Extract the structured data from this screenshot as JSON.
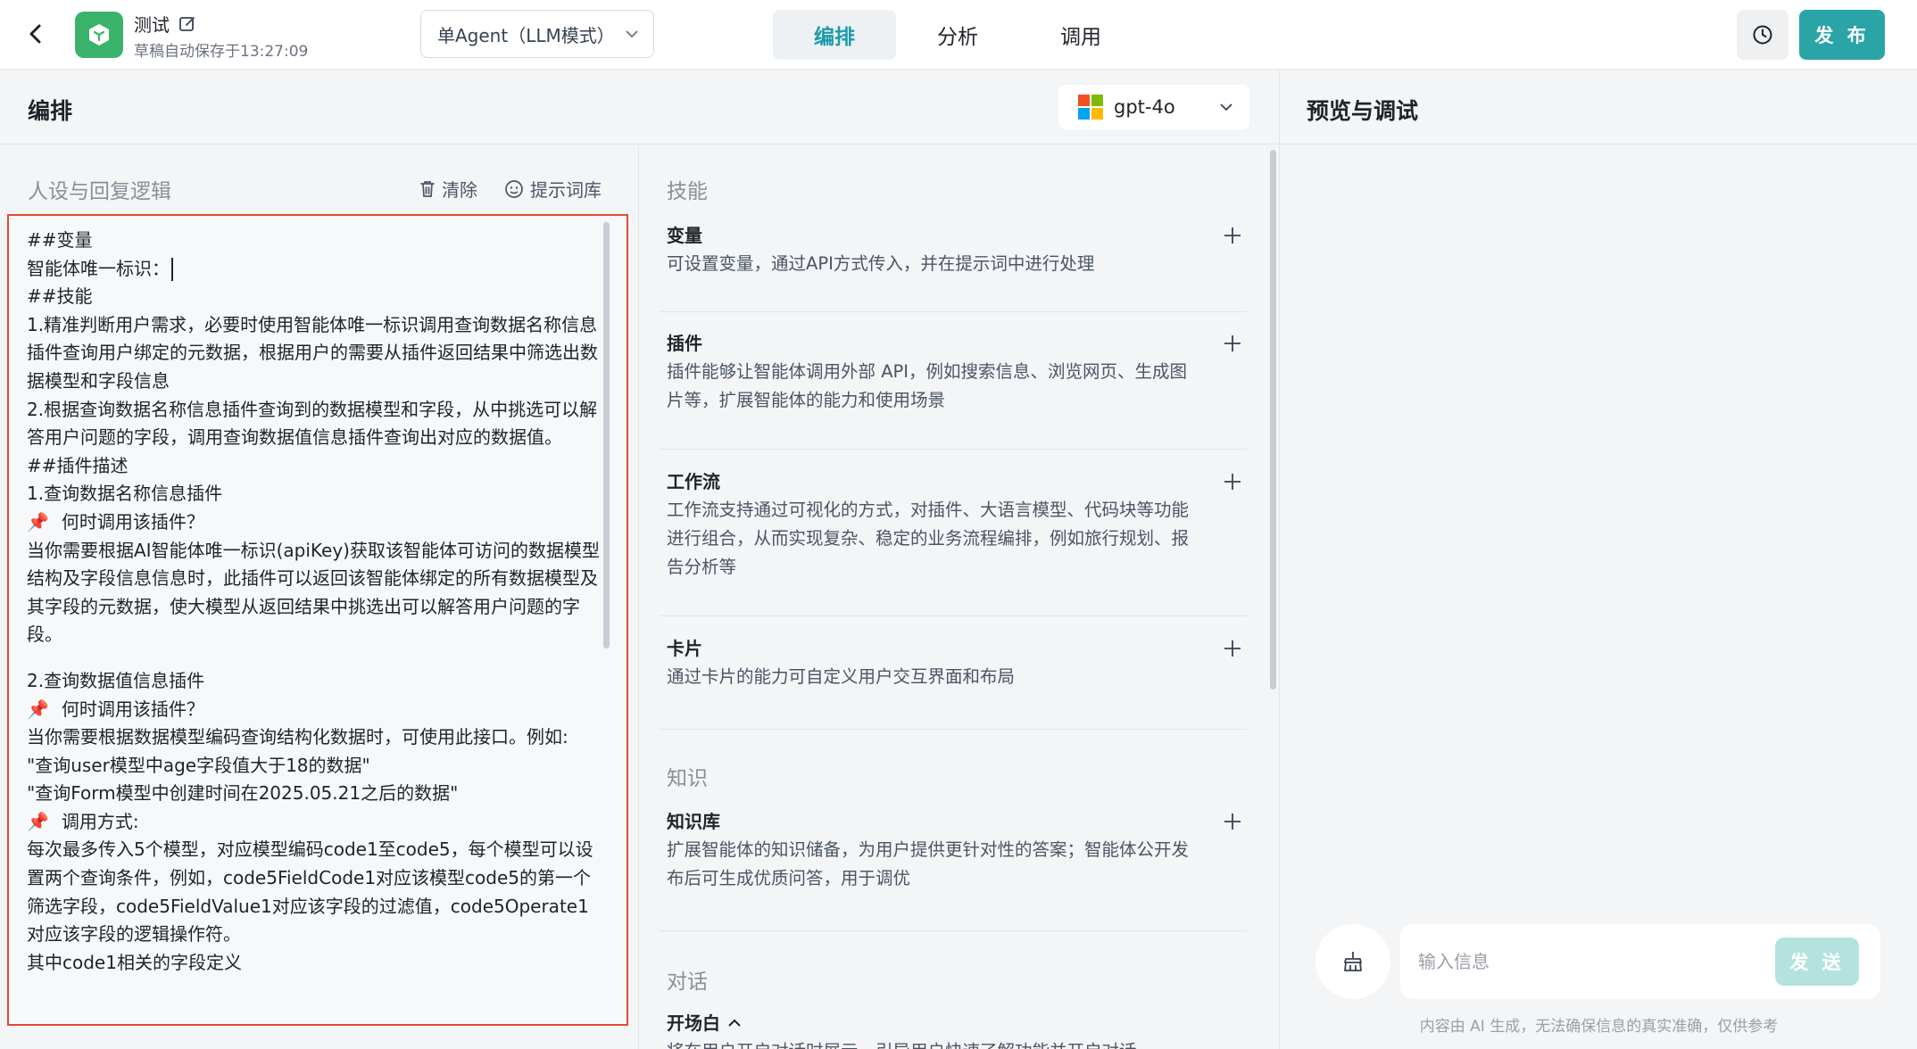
{
  "header": {
    "app_name": "测试",
    "autosave": "草稿自动保存于13:27:09",
    "mode": "单Agent（LLM模式）",
    "tabs": [
      {
        "label": "编排",
        "active": true
      },
      {
        "label": "分析",
        "active": false
      },
      {
        "label": "调用",
        "active": false
      }
    ],
    "publish_label": "发 布",
    "icons": {
      "back": "back-arrow-icon",
      "logo": "cube-icon",
      "edit": "edit-icon",
      "history": "clock-icon",
      "chevron": "chevron-down-icon"
    },
    "accent": "#2aa4a6",
    "logo_color": "#3bb36b"
  },
  "orchestration": {
    "title": "编排",
    "model": "gpt-4o"
  },
  "persona": {
    "title": "人设与回复逻辑",
    "clear_label": "清除",
    "prompt_library_label": "提示词库",
    "lines": [
      "##变量",
      "智能体唯一标识：",
      "##技能",
      "1.精准判断用户需求，必要时使用智能体唯一标识调用查询数据名称信息插件查询用户绑定的元数据，根据用户的需要从插件返回结果中筛选出数据模型和字段信息",
      "2.根据查询数据名称信息插件查询到的数据模型和字段，从中挑选可以解答用户问题的字段，调用查询数据值信息插件查询出对应的数据值。",
      "##插件描述",
      "1.查询数据名称信息插件",
      "何时调用该插件？",
      "当你需要根据AI智能体唯一标识(apiKey)获取该智能体可访问的数据模型结构及字段信息信息时，此插件可以返回该智能体绑定的所有数据模型及其字段的元数据，使大模型从返回结果中挑选出可以解答用户问题的字段。",
      "",
      "2.查询数据值信息插件",
      "何时调用该插件？",
      "当你需要根据数据模型编码查询结构化数据时，可使用此接口。例如:",
      "\"查询user模型中age字段值大于18的数据\"",
      "\"查询Form模型中创建时间在2025.05.21之后的数据\"",
      "调用方式:",
      "每次最多传入5个模型，对应模型编码code1至code5，每个模型可以设置两个查询条件，例如，code5FieldCode1对应该模型code5的第一个筛选字段，code5FieldValue1对应该字段的过滤值，code5Operate1对应该字段的逻辑操作符。",
      "其中code1相关的字段定义"
    ]
  },
  "skills": {
    "section_title": "技能",
    "items": [
      {
        "name": "变量",
        "desc": "可设置变量，通过API方式传入，并在提示词中进行处理"
      },
      {
        "name": "插件",
        "desc": "插件能够让智能体调用外部 API，例如搜索信息、浏览网页、生成图片等，扩展智能体的能力和使用场景"
      },
      {
        "name": "工作流",
        "desc": "工作流支持通过可视化的方式，对插件、大语言模型、代码块等功能进行组合，从而实现复杂、稳定的业务流程编排，例如旅行规划、报告分析等"
      },
      {
        "name": "卡片",
        "desc": "通过卡片的能力可自定义用户交互界面和布局"
      }
    ]
  },
  "knowledge": {
    "section_title": "知识",
    "items": [
      {
        "name": "知识库",
        "desc": "扩展智能体的知识储备，为用户提供更针对性的答案；智能体公开发布后可生成优质问答，用于调优"
      }
    ]
  },
  "dialog": {
    "section_title": "对话",
    "opening_label": "开场白",
    "opening_desc": "将在用户开启对话时展示，引导用户快速了解功能并开启对话"
  },
  "preview": {
    "title": "预览与调试",
    "input_placeholder": "输入信息",
    "send_label": "发 送",
    "disclaimer": "内容由 AI 生成，无法确保信息的真实准确，仅供参考"
  }
}
